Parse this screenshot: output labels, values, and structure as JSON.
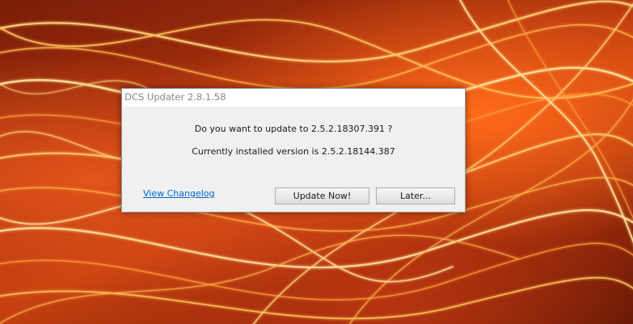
{
  "dialog": {
    "title": "DCS Updater 2.8.1.58",
    "message_update": "Do you want to update to 2.5.2.18307.391 ?",
    "message_installed": "Currently installed version is 2.5.2.18144.387",
    "changelog_link": "View Changelog",
    "update_button": "Update Now!",
    "later_button": "Later..."
  },
  "colors": {
    "wallpaper": "#b8350f",
    "dialog_bg": "#f0f0f0",
    "link": "#0066cc"
  }
}
